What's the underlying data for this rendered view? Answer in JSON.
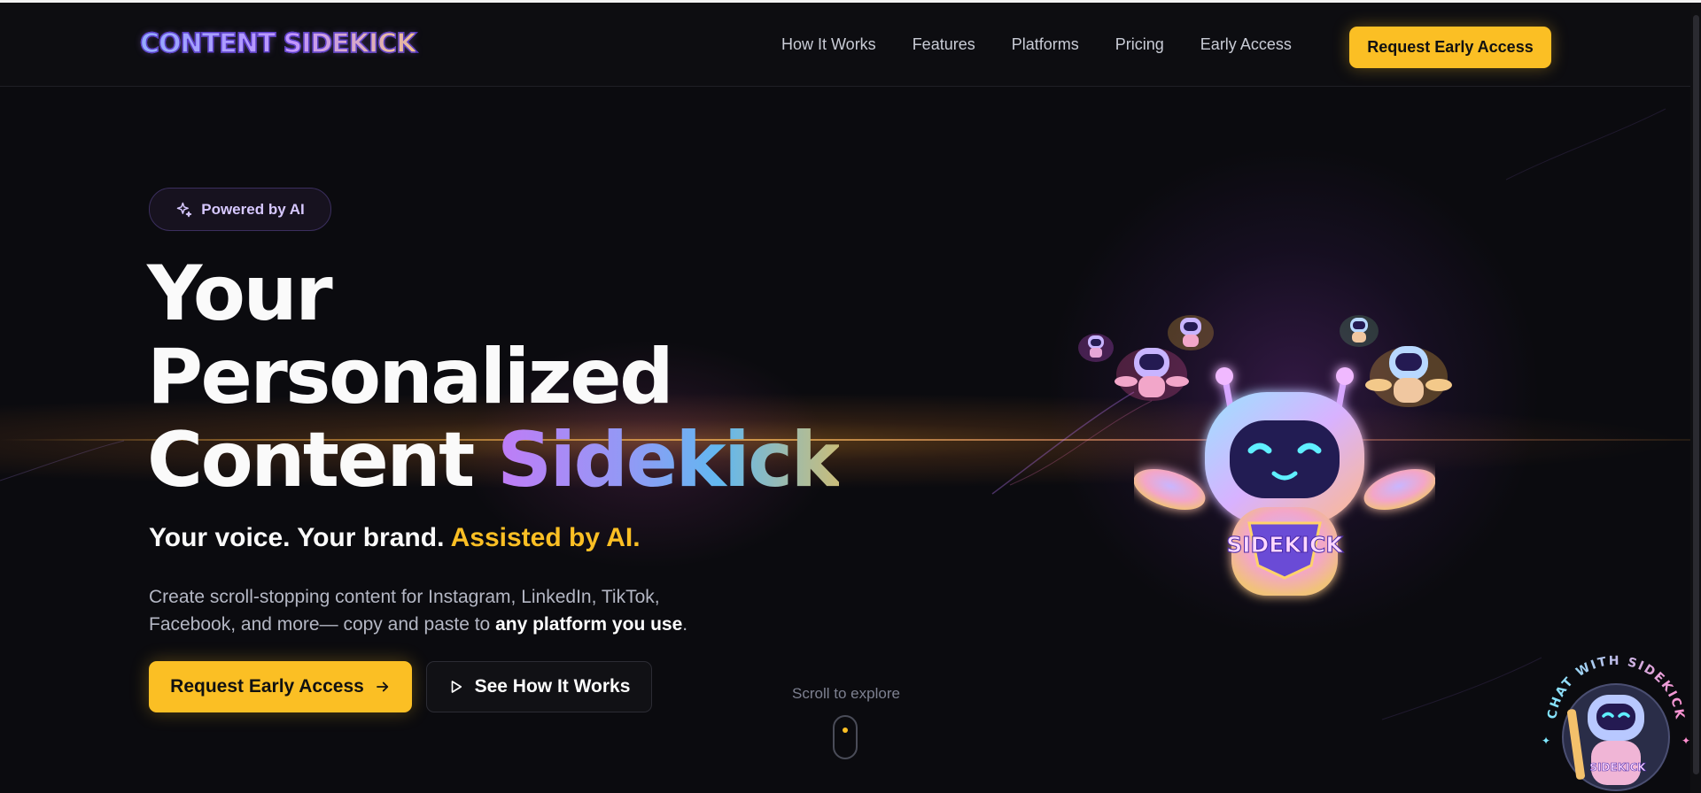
{
  "header": {
    "logo_text": "CONTENT SIDEKICK",
    "nav": [
      "How It Works",
      "Features",
      "Platforms",
      "Pricing",
      "Early Access"
    ],
    "cta_label": "Request Early Access"
  },
  "hero": {
    "badge_label": "Powered by AI",
    "title_line1": "Your",
    "title_line2": "Personalized",
    "title_line3_plain": "Content ",
    "title_line3_accent": "Sidekick",
    "tagline_plain": "Your voice. Your brand. ",
    "tagline_accent": "Assisted by AI.",
    "description_line1": "Create scroll-stopping content for Instagram, LinkedIn, TikTok,",
    "description_line2": "Facebook, and more— copy and paste to ",
    "description_bold": "any platform you use",
    "description_end": ".",
    "primary_button": "Request Early Access",
    "secondary_button": "See How It Works",
    "scroll_hint": "Scroll to explore",
    "robot_badge": "SIDEKICK"
  },
  "chat_widget": {
    "ring_text": "CHAT WITH SIDEKICK",
    "badge": "SIDEKICK"
  },
  "icons": [
    "sparkle-icon",
    "arrow-right-icon",
    "play-icon",
    "mouse-scroll-icon"
  ],
  "colors": {
    "accent_gold": "#fbbf24",
    "background": "#0b0b0f",
    "accent_purple": "#c07cf6"
  }
}
